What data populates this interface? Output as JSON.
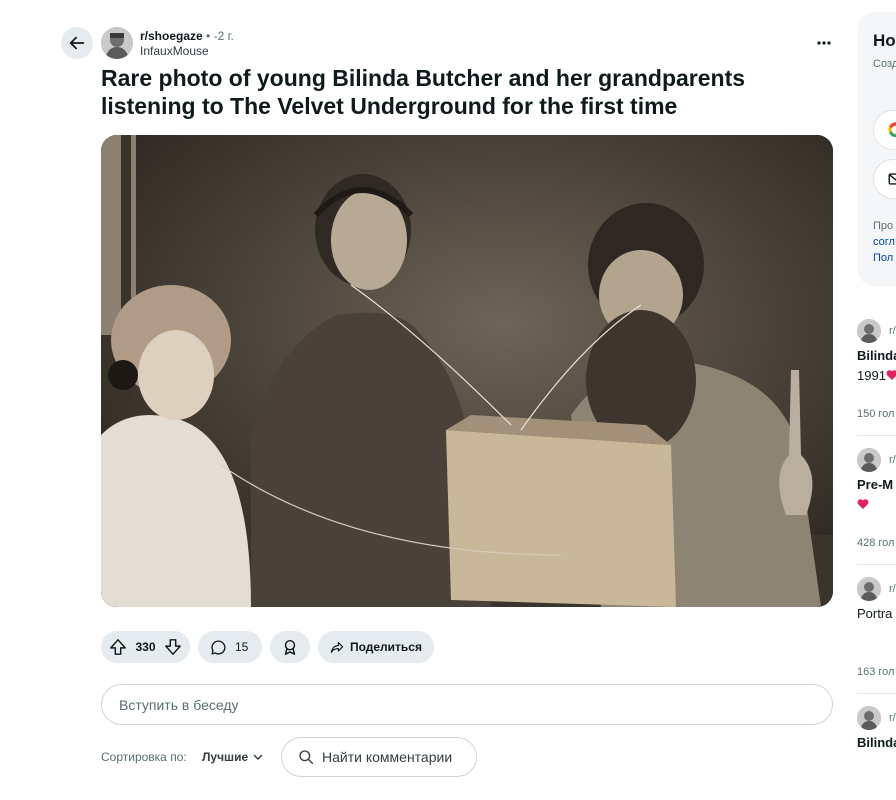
{
  "post": {
    "subreddit": "r/shoegaze",
    "separator": "•",
    "age": "-2 г.",
    "author": "InfauxMouse",
    "title": "Rare photo of young Bilinda Butcher and her grandparents listening to The Velvet Underground for the first time"
  },
  "actions": {
    "upvotes": "330",
    "comments": "15",
    "share_label": "Поделиться"
  },
  "comment_box": {
    "placeholder": "Вступить в беседу"
  },
  "sort": {
    "label": "Сортировка по:",
    "value": "Лучшие"
  },
  "search_comments": {
    "label": "Найти комментарии"
  },
  "sidebar": {
    "login": {
      "heading": "Но",
      "desc": "Созд цель",
      "legal": "Про согл",
      "legal_link1": "согл",
      "legal_link2": "Пол"
    },
    "related": [
      {
        "sub": "r/",
        "title": "Bilinda",
        "line2": "1991",
        "votes": "150 гол"
      },
      {
        "sub": "r/",
        "title": "Pre-M",
        "line2": "",
        "votes": "428 гол"
      },
      {
        "sub": "r/",
        "title": "Portra",
        "line2": "",
        "votes": "163 гол"
      },
      {
        "sub": "r/",
        "title": "Bilinda",
        "line2": "",
        "votes": ""
      }
    ]
  },
  "colors": {
    "pill_bg": "#e5ebee",
    "text": "#0f1a1c",
    "muted": "#576f76",
    "link": "#0045ac",
    "heart": "#e0245e"
  },
  "icons": [
    "back-arrow-icon",
    "more-icon",
    "upvote-icon",
    "downvote-icon",
    "comment-icon",
    "award-icon",
    "share-icon",
    "chevron-down-icon",
    "search-icon",
    "google-icon",
    "mail-icon",
    "heart-icon"
  ]
}
